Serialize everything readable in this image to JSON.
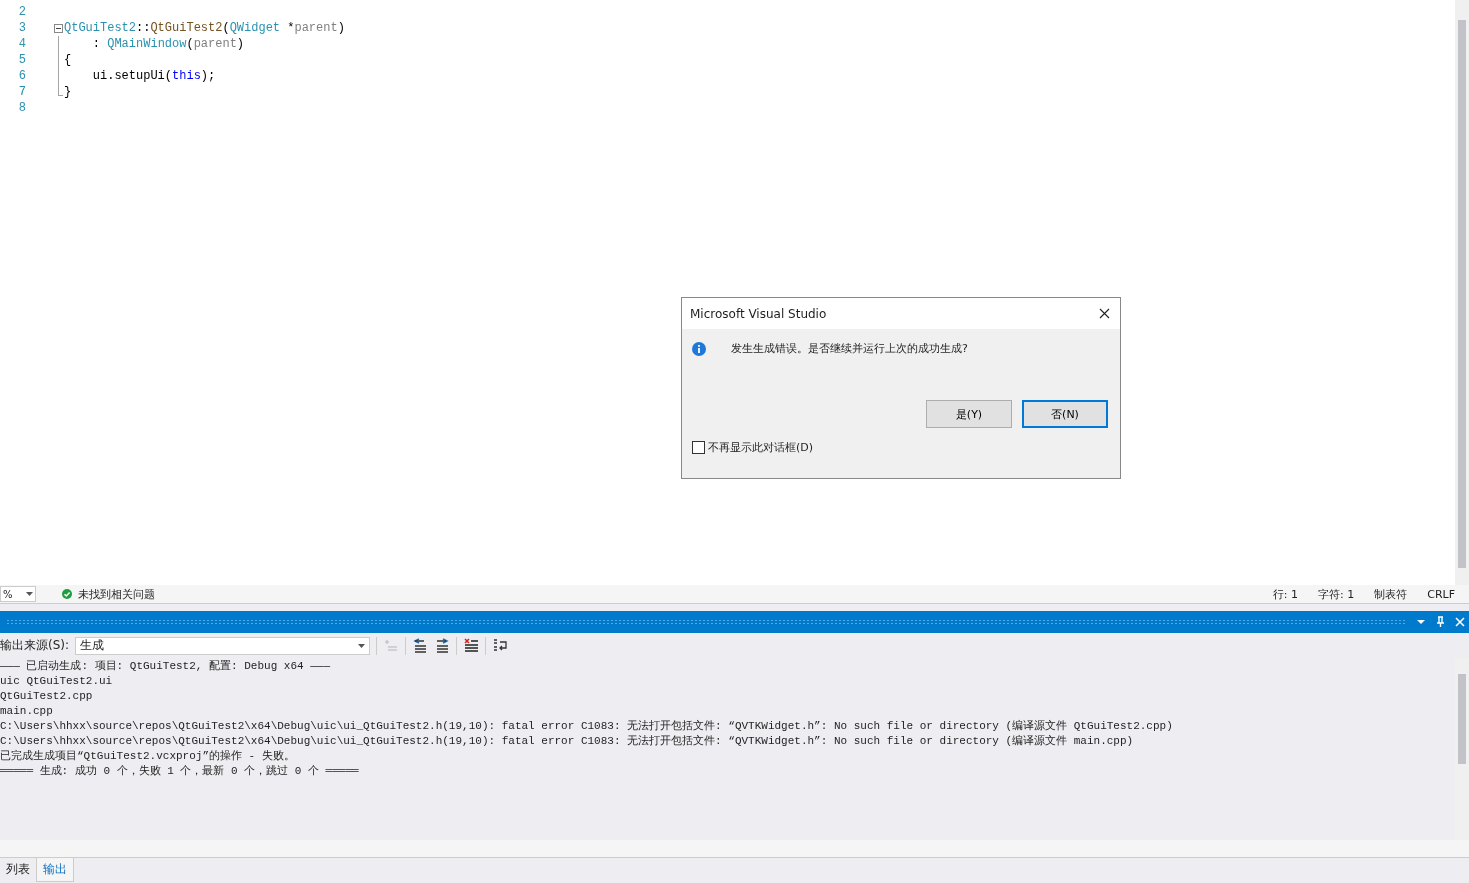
{
  "editor": {
    "lines": [
      {
        "number": "2"
      },
      {
        "number": "3",
        "kind": "fold_start",
        "tokens": [
          {
            "text": "QtGuiTest2",
            "kind": "type"
          },
          {
            "text": "::",
            "kind": "plain"
          },
          {
            "text": "QtGuiTest2",
            "kind": "func"
          },
          {
            "text": "(",
            "kind": "plain"
          },
          {
            "text": "QWidget",
            "kind": "type"
          },
          {
            "text": " *",
            "kind": "plain"
          },
          {
            "text": "parent",
            "kind": "param"
          },
          {
            "text": ")",
            "kind": "plain"
          }
        ]
      },
      {
        "number": "4",
        "kind": "fold_inside",
        "tokens": [
          {
            "text": "    : ",
            "kind": "plain"
          },
          {
            "text": "QMainWindow",
            "kind": "type"
          },
          {
            "text": "(",
            "kind": "plain"
          },
          {
            "text": "parent",
            "kind": "param"
          },
          {
            "text": ")",
            "kind": "plain"
          }
        ]
      },
      {
        "number": "5",
        "kind": "fold_inside",
        "tokens": [
          {
            "text": "{",
            "kind": "plain"
          }
        ]
      },
      {
        "number": "6",
        "kind": "fold_inside",
        "tokens": [
          {
            "text": "    ui.setupUi(",
            "kind": "plain"
          },
          {
            "text": "this",
            "kind": "keyword"
          },
          {
            "text": ");",
            "kind": "plain"
          }
        ]
      },
      {
        "number": "7",
        "kind": "fold_end",
        "tokens": [
          {
            "text": "}",
            "kind": "plain"
          }
        ]
      },
      {
        "number": "8"
      }
    ]
  },
  "dialog": {
    "title": "Microsoft Visual Studio",
    "message": "发生生成错误。是否继续并运行上次的成功生成?",
    "buttons": [
      {
        "label": "是(Y)",
        "default": false
      },
      {
        "label": "否(N)",
        "default": true
      }
    ],
    "checkbox": {
      "label": "不再显示此对话框(D)",
      "checked": false
    }
  },
  "status_bar": {
    "zoom": "%",
    "issues": "未找到相关问题",
    "items": [
      "行: 1",
      "字符: 1",
      "制表符",
      "CRLF"
    ]
  },
  "output": {
    "source_label": "输出来源(S):",
    "source_value": "生成",
    "lines": [
      "——— 已启动生成: 项目: QtGuiTest2, 配置: Debug x64 ———",
      "uic QtGuiTest2.ui",
      "QtGuiTest2.cpp",
      "main.cpp",
      "C:\\Users\\hhxx\\source\\repos\\QtGuiTest2\\x64\\Debug\\uic\\ui_QtGuiTest2.h(19,10): fatal error C1083: 无法打开包括文件: “QVTKWidget.h”: No such file or directory (编译源文件 QtGuiTest2.cpp)",
      "C:\\Users\\hhxx\\source\\repos\\QtGuiTest2\\x64\\Debug\\uic\\ui_QtGuiTest2.h(19,10): fatal error C1083: 无法打开包括文件: “QVTKWidget.h”: No such file or directory (编译源文件 main.cpp)",
      "已完成生成项目“QtGuiTest2.vcxproj”的操作 - 失败。",
      "═════ 生成: 成功 0 个，失败 1 个，最新 0 个，跳过 0 个 ═════"
    ]
  },
  "bottom_tabs": [
    {
      "label": "列表",
      "selected": false
    },
    {
      "label": "输出",
      "selected": true
    }
  ]
}
